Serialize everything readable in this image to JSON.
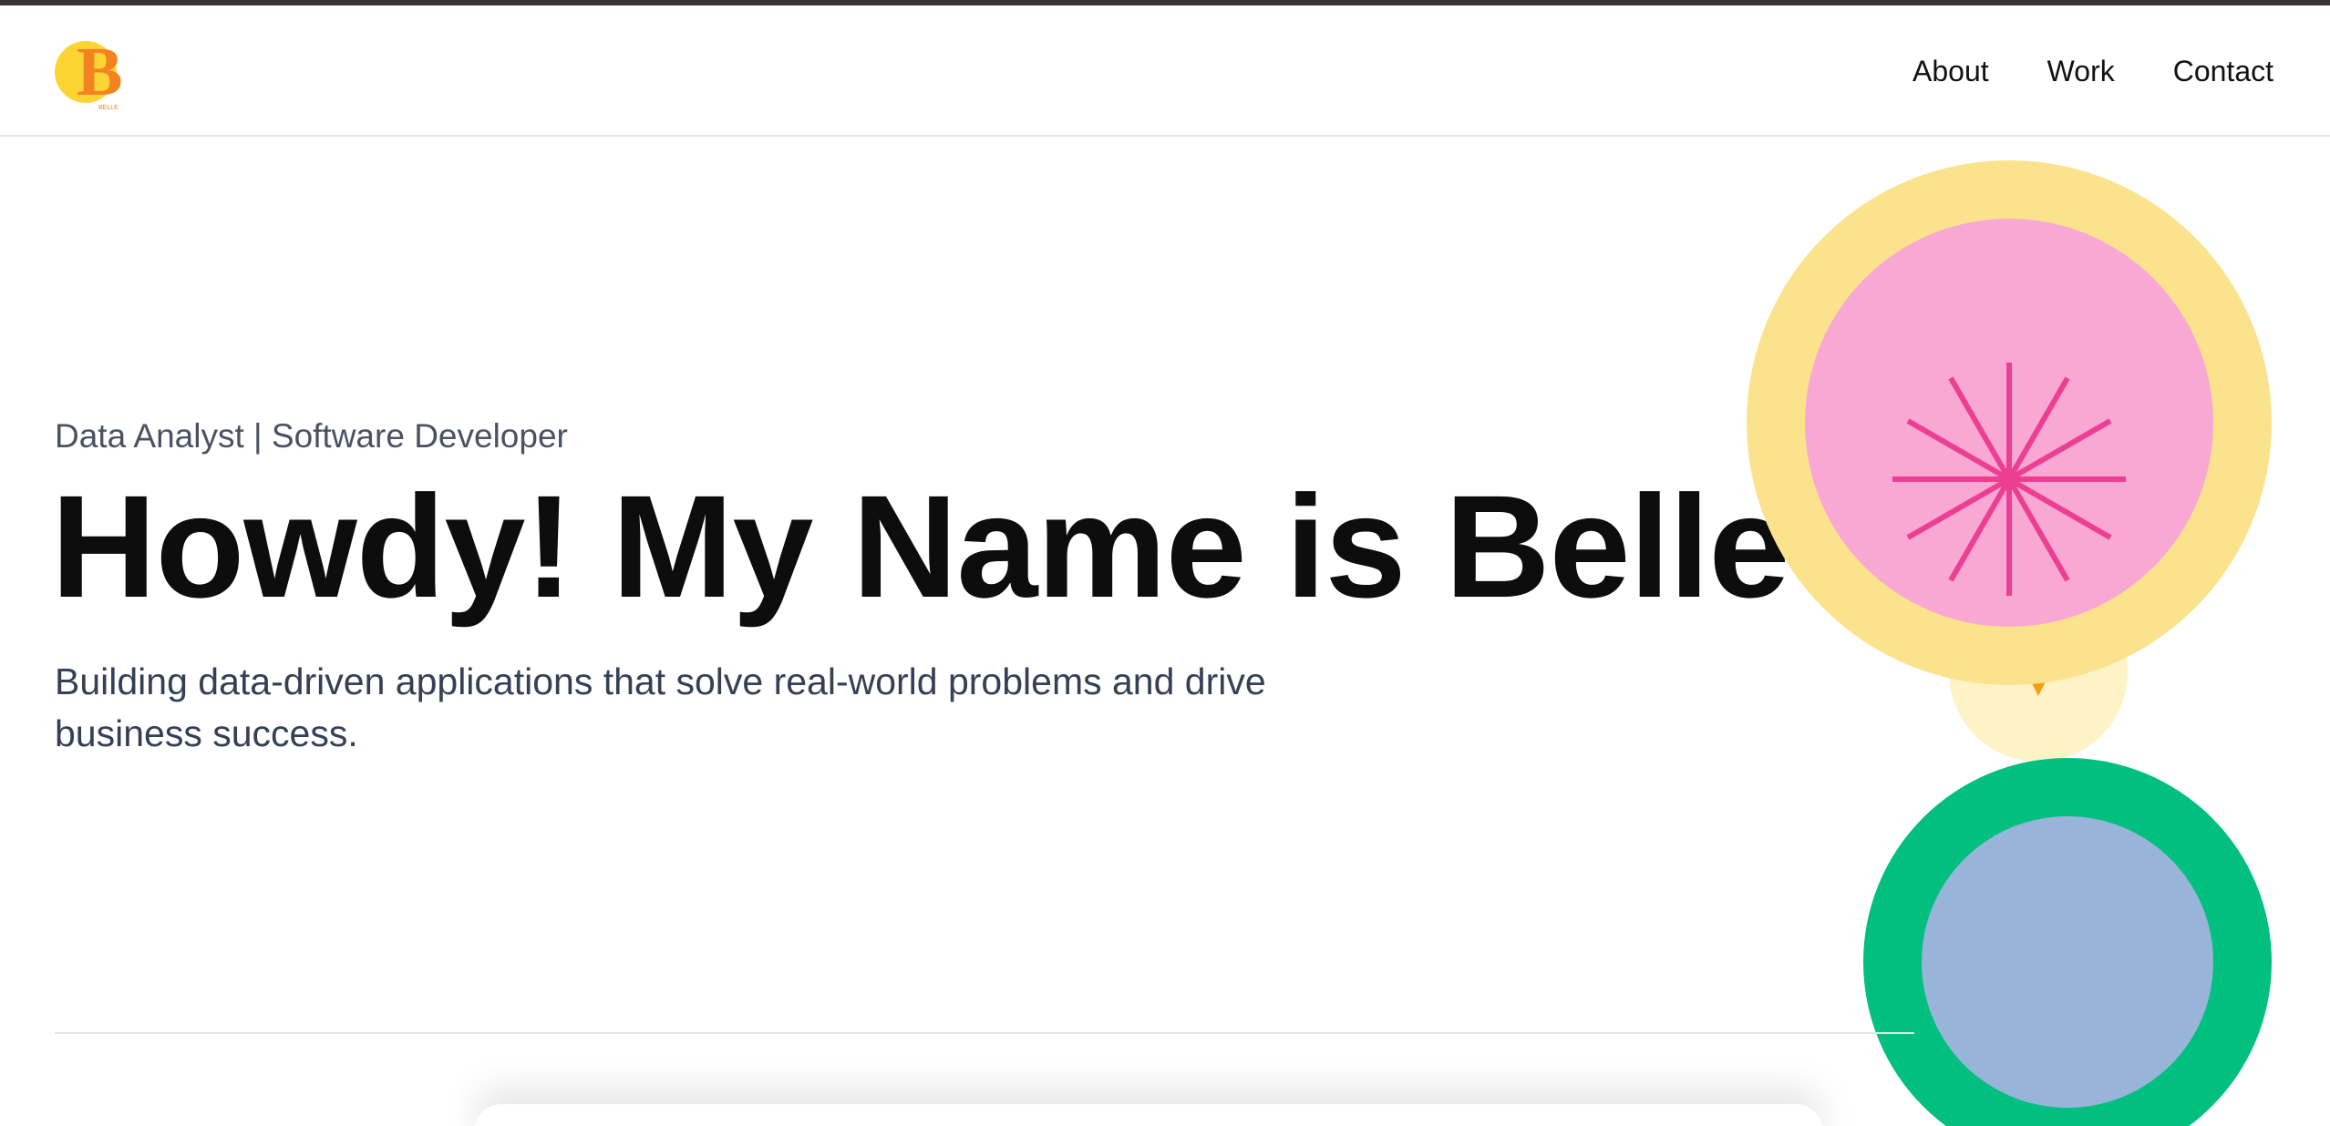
{
  "header": {
    "logo_letter": "B",
    "logo_caption": "BELLE",
    "nav": [
      {
        "label": "About"
      },
      {
        "label": "Work"
      },
      {
        "label": "Contact"
      }
    ]
  },
  "hero": {
    "subtitle": "Data Analyst | Software Developer",
    "headline": "Howdy! My Name is Belle",
    "tagline": "Building data-driven applications that solve real-world problems and drive business success."
  },
  "colors": {
    "yellow_ring": "#fbe38e",
    "pink_disc": "#f9a8d4",
    "pink_burst": "#ec3f93",
    "pale_yellow": "#fef3c7",
    "orange_mark": "#f59e0b",
    "green_ring": "#00bf7f",
    "blue_disc": "#98b4d8",
    "logo_yellow": "#fcd535",
    "logo_orange": "#f58220"
  },
  "icons": {
    "logo": "b-monogram-logo",
    "burst": "asterisk-burst-icon"
  }
}
